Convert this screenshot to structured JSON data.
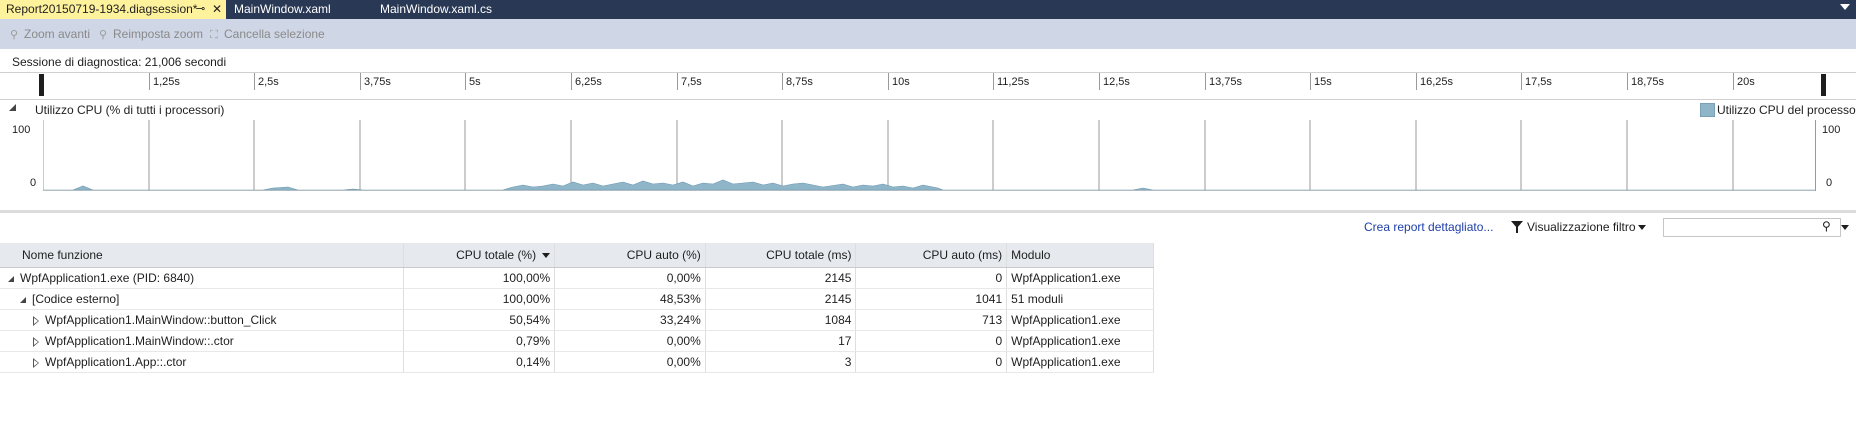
{
  "tabs": [
    {
      "label": "Report20150719-1934.diagsession*",
      "active": true
    },
    {
      "label": "MainWindow.xaml",
      "active": false
    },
    {
      "label": "MainWindow.xaml.cs",
      "active": false
    }
  ],
  "toolbar": {
    "zoom_in": "Zoom avanti",
    "reset_zoom": "Reimposta zoom",
    "clear_selection": "Cancella selezione"
  },
  "session": {
    "label": "Sessione di diagnostica: 21,006 secondi"
  },
  "ruler": {
    "ticks": [
      "1,25s",
      "2,5s",
      "3,75s",
      "5s",
      "6,25s",
      "7,5s",
      "8,75s",
      "10s",
      "11,25s",
      "12,5s",
      "13,75s",
      "15s",
      "16,25s",
      "17,5s",
      "18,75s",
      "20s"
    ]
  },
  "cpu": {
    "title": "Utilizzo CPU (% di tutti i processori)",
    "legend": "Utilizzo CPU del processo",
    "y_max": "100",
    "y_min": "0",
    "color": "#8fb5c9"
  },
  "report": {
    "link": "Crea report dettagliato...",
    "filter": "Visualizzazione filtro"
  },
  "table": {
    "headers": [
      "Nome funzione",
      "CPU totale (%)",
      "CPU auto (%)",
      "CPU totale (ms)",
      "CPU auto (ms)",
      "Modulo"
    ],
    "rows": [
      {
        "name": "WpfApplication1.exe (PID: 6840)",
        "cpu_total_pct": "100,00%",
        "cpu_self_pct": "0,00%",
        "cpu_total_ms": "2145",
        "cpu_self_ms": "0",
        "module": "WpfApplication1.exe"
      },
      {
        "name": "[Codice esterno]",
        "cpu_total_pct": "100,00%",
        "cpu_self_pct": "48,53%",
        "cpu_total_ms": "2145",
        "cpu_self_ms": "1041",
        "module": "51 moduli"
      },
      {
        "name": "WpfApplication1.MainWindow::button_Click",
        "cpu_total_pct": "50,54%",
        "cpu_self_pct": "33,24%",
        "cpu_total_ms": "1084",
        "cpu_self_ms": "713",
        "module": "WpfApplication1.exe"
      },
      {
        "name": "WpfApplication1.MainWindow::.ctor",
        "cpu_total_pct": "0,79%",
        "cpu_self_pct": "0,00%",
        "cpu_total_ms": "17",
        "cpu_self_ms": "0",
        "module": "WpfApplication1.exe"
      },
      {
        "name": "WpfApplication1.App::.ctor",
        "cpu_total_pct": "0,14%",
        "cpu_self_pct": "0,00%",
        "cpu_total_ms": "3",
        "cpu_self_ms": "0",
        "module": "WpfApplication1.exe"
      }
    ]
  }
}
